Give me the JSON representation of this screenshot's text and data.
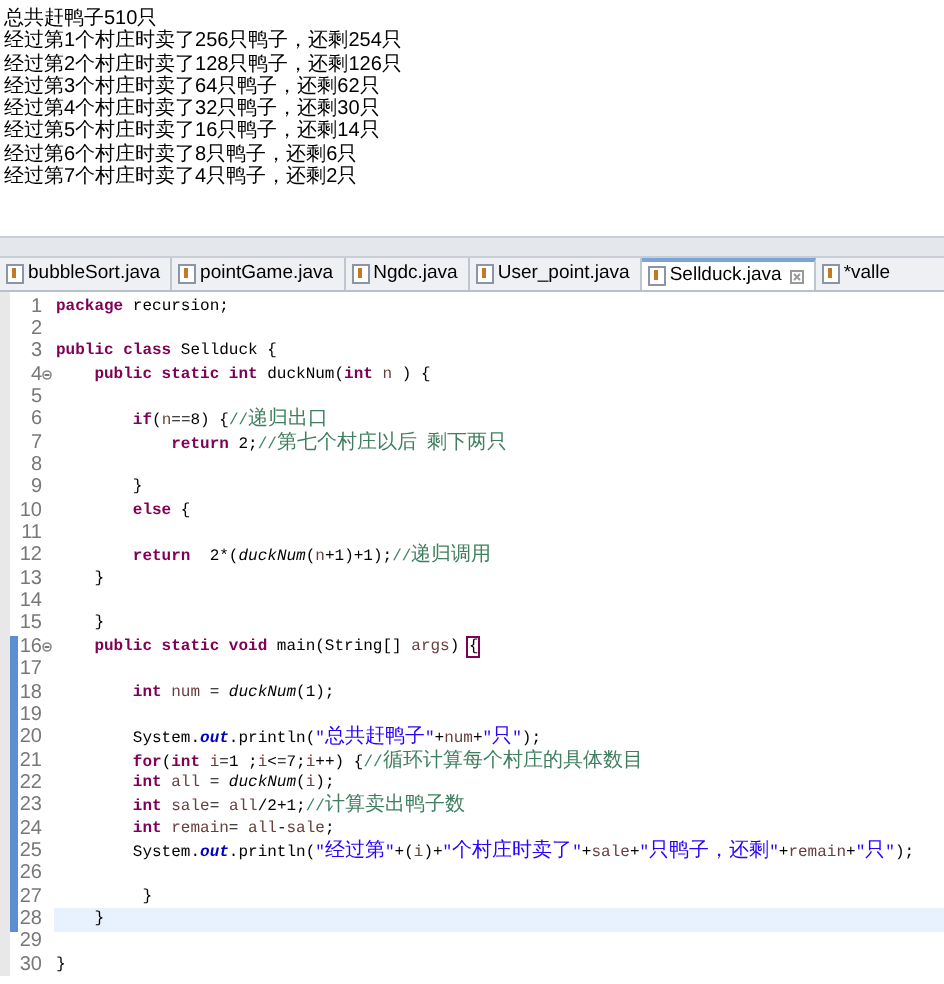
{
  "console": {
    "lines": [
      "总共赶鸭子510只",
      "经过第1个村庄时卖了256只鸭子，还剩254只",
      "经过第2个村庄时卖了128只鸭子，还剩126只",
      "经过第3个村庄时卖了64只鸭子，还剩62只",
      "经过第4个村庄时卖了32只鸭子，还剩30只",
      "经过第5个村庄时卖了16只鸭子，还剩14只",
      "经过第6个村庄时卖了8只鸭子，还剩6只",
      "经过第7个村庄时卖了4只鸭子，还剩2只"
    ]
  },
  "tabs": [
    {
      "label": "bubbleSort.java",
      "selected": false
    },
    {
      "label": "pointGame.java",
      "selected": false
    },
    {
      "label": "Ngdc.java",
      "selected": false
    },
    {
      "label": "User_point.java",
      "selected": false
    },
    {
      "label": "Sellduck.java",
      "selected": true
    },
    {
      "label": "*valle",
      "selected": false
    }
  ],
  "editor": {
    "lines": [
      {
        "number": "1",
        "tokens": [
          {
            "kind": "kw",
            "text": "package"
          },
          {
            "kind": "plain",
            "text": " recursion;"
          }
        ]
      },
      {
        "number": "2"
      },
      {
        "number": "3",
        "tokens": [
          {
            "kind": "kw",
            "text": "public class"
          },
          {
            "kind": "plain",
            "text": " Sellduck {"
          }
        ]
      },
      {
        "number": "4",
        "fold": true,
        "tokens": [
          {
            "kind": "kw",
            "text": "    public static int"
          },
          {
            "kind": "plain",
            "text": " duckNum("
          },
          {
            "kind": "kw",
            "text": "int"
          },
          {
            "kind": "var",
            "text": " n"
          },
          {
            "kind": "plain",
            "text": " ) {"
          }
        ]
      },
      {
        "number": "5"
      },
      {
        "number": "6",
        "tokens": [
          {
            "kind": "kw",
            "text": "        if"
          },
          {
            "kind": "plain",
            "text": "("
          },
          {
            "kind": "var",
            "text": "n"
          },
          {
            "kind": "plain",
            "text": "==8) {"
          },
          {
            "kind": "comment",
            "text": "//递归出口"
          }
        ]
      },
      {
        "number": "7",
        "tokens": [
          {
            "kind": "kw",
            "text": "            return"
          },
          {
            "kind": "plain",
            "text": " 2;"
          },
          {
            "kind": "comment",
            "text": "//第七个村庄以后 剩下两只"
          }
        ]
      },
      {
        "number": "8"
      },
      {
        "number": "9",
        "tokens": [
          {
            "kind": "plain",
            "text": "        }"
          }
        ]
      },
      {
        "number": "10",
        "tokens": [
          {
            "kind": "kw",
            "text": "        else"
          },
          {
            "kind": "plain",
            "text": " {"
          }
        ]
      },
      {
        "number": "11"
      },
      {
        "number": "12",
        "tokens": [
          {
            "kind": "kw",
            "text": "        return"
          },
          {
            "kind": "plain",
            "text": "  2*("
          },
          {
            "kind": "method",
            "text": "duckNum"
          },
          {
            "kind": "plain",
            "text": "("
          },
          {
            "kind": "var",
            "text": "n"
          },
          {
            "kind": "plain",
            "text": "+1)+1);"
          },
          {
            "kind": "comment",
            "text": "//递归调用"
          }
        ]
      },
      {
        "number": "13",
        "tokens": [
          {
            "kind": "plain",
            "text": "    }"
          }
        ]
      },
      {
        "number": "14"
      },
      {
        "number": "15",
        "tokens": [
          {
            "kind": "plain",
            "text": "    }"
          }
        ]
      },
      {
        "number": "16",
        "fold": true,
        "marked": true,
        "tokens": [
          {
            "kind": "kw",
            "text": "    public static void"
          },
          {
            "kind": "plain",
            "text": " main(String[] "
          },
          {
            "kind": "var",
            "text": "args"
          },
          {
            "kind": "plain",
            "text": ") "
          },
          {
            "kind": "bracket",
            "text": "{"
          }
        ]
      },
      {
        "number": "17",
        "marked": true
      },
      {
        "number": "18",
        "marked": true,
        "tokens": [
          {
            "kind": "kw",
            "text": "        int"
          },
          {
            "kind": "var",
            "text": " num"
          },
          {
            "kind": "plain",
            "text": " = "
          },
          {
            "kind": "method",
            "text": "duckNum"
          },
          {
            "kind": "plain",
            "text": "(1);"
          }
        ]
      },
      {
        "number": "19",
        "marked": true
      },
      {
        "number": "20",
        "marked": true,
        "tokens": [
          {
            "kind": "plain",
            "text": "        System."
          },
          {
            "kind": "field",
            "text": "out"
          },
          {
            "kind": "plain",
            "text": ".println("
          },
          {
            "kind": "string",
            "text": "\"总共赶鸭子\""
          },
          {
            "kind": "plain",
            "text": "+"
          },
          {
            "kind": "var",
            "text": "num"
          },
          {
            "kind": "plain",
            "text": "+"
          },
          {
            "kind": "string",
            "text": "\"只\""
          },
          {
            "kind": "plain",
            "text": ");"
          }
        ]
      },
      {
        "number": "21",
        "marked": true,
        "tokens": [
          {
            "kind": "kw",
            "text": "        for"
          },
          {
            "kind": "plain",
            "text": "("
          },
          {
            "kind": "kw",
            "text": "int"
          },
          {
            "kind": "var",
            "text": " i"
          },
          {
            "kind": "plain",
            "text": "=1 ;"
          },
          {
            "kind": "var",
            "text": "i"
          },
          {
            "kind": "plain",
            "text": "<=7;"
          },
          {
            "kind": "var",
            "text": "i"
          },
          {
            "kind": "plain",
            "text": "++) {"
          },
          {
            "kind": "comment",
            "text": "//循环计算每个村庄的具体数目"
          }
        ]
      },
      {
        "number": "22",
        "marked": true,
        "tokens": [
          {
            "kind": "kw",
            "text": "        int"
          },
          {
            "kind": "var",
            "text": " all"
          },
          {
            "kind": "plain",
            "text": " = "
          },
          {
            "kind": "method",
            "text": "duckNum"
          },
          {
            "kind": "plain",
            "text": "("
          },
          {
            "kind": "var",
            "text": "i"
          },
          {
            "kind": "plain",
            "text": ");"
          }
        ]
      },
      {
        "number": "23",
        "marked": true,
        "tokens": [
          {
            "kind": "kw",
            "text": "        int"
          },
          {
            "kind": "var",
            "text": " sale"
          },
          {
            "kind": "plain",
            "text": "= "
          },
          {
            "kind": "var",
            "text": "all"
          },
          {
            "kind": "plain",
            "text": "/2+1;"
          },
          {
            "kind": "comment",
            "text": "//计算卖出鸭子数"
          }
        ]
      },
      {
        "number": "24",
        "marked": true,
        "tokens": [
          {
            "kind": "kw",
            "text": "        int"
          },
          {
            "kind": "var",
            "text": " remain"
          },
          {
            "kind": "plain",
            "text": "= "
          },
          {
            "kind": "var",
            "text": "all"
          },
          {
            "kind": "plain",
            "text": "-"
          },
          {
            "kind": "var",
            "text": "sale"
          },
          {
            "kind": "plain",
            "text": ";"
          }
        ]
      },
      {
        "number": "25",
        "marked": true,
        "tokens": [
          {
            "kind": "plain",
            "text": "        System."
          },
          {
            "kind": "field",
            "text": "out"
          },
          {
            "kind": "plain",
            "text": ".println("
          },
          {
            "kind": "string",
            "text": "\"经过第\""
          },
          {
            "kind": "plain",
            "text": "+("
          },
          {
            "kind": "var",
            "text": "i"
          },
          {
            "kind": "plain",
            "text": ")+"
          },
          {
            "kind": "string",
            "text": "\"个村庄时卖了\""
          },
          {
            "kind": "plain",
            "text": "+"
          },
          {
            "kind": "var",
            "text": "sale"
          },
          {
            "kind": "plain",
            "text": "+"
          },
          {
            "kind": "string",
            "text": "\"只鸭子，还剩\""
          },
          {
            "kind": "plain",
            "text": "+"
          },
          {
            "kind": "var",
            "text": "remain"
          },
          {
            "kind": "plain",
            "text": "+"
          },
          {
            "kind": "string",
            "text": "\"只\""
          },
          {
            "kind": "plain",
            "text": ");"
          }
        ]
      },
      {
        "number": "26",
        "marked": true
      },
      {
        "number": "27",
        "marked": true,
        "tokens": [
          {
            "kind": "plain",
            "text": "         }"
          }
        ]
      },
      {
        "number": "28",
        "marked": true,
        "current": true,
        "tokens": [
          {
            "kind": "plain",
            "text": "    }"
          }
        ]
      },
      {
        "number": "29"
      },
      {
        "number": "30",
        "tokens": [
          {
            "kind": "plain",
            "text": "}"
          }
        ]
      }
    ]
  }
}
